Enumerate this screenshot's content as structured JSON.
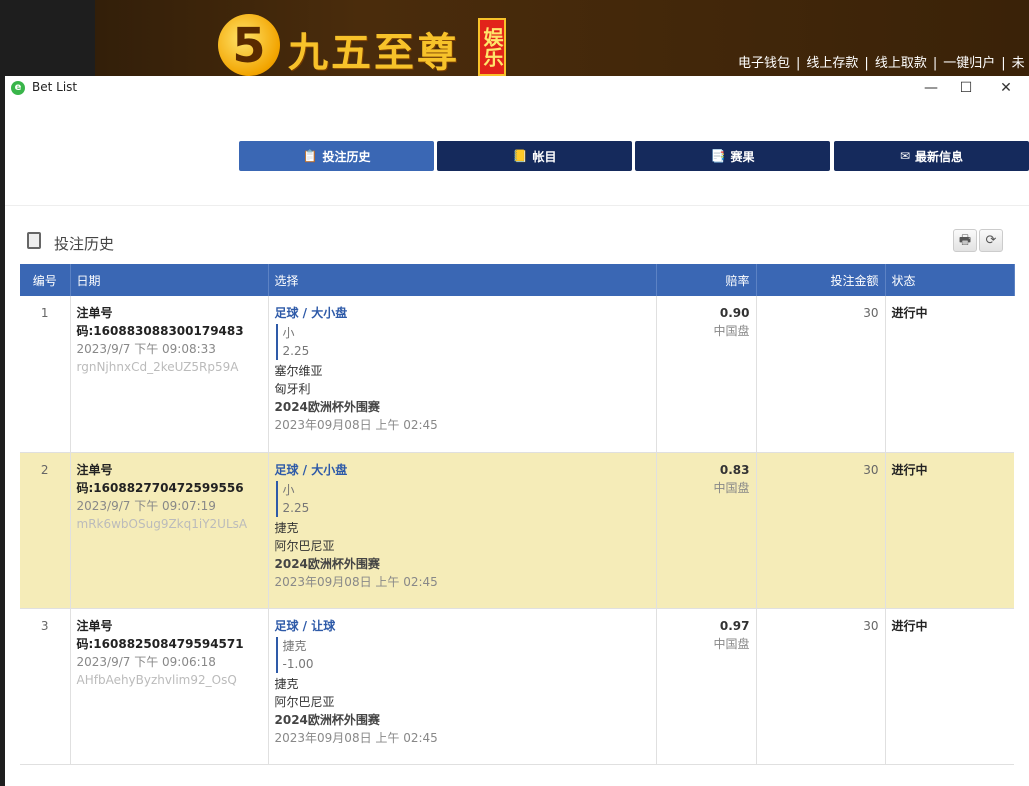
{
  "banner": {
    "logo_char": "5",
    "brand_name": "九五至尊",
    "brand_tag": "娱乐城",
    "links": [
      "电子钱包",
      "线上存款",
      "线上取款",
      "一键归户",
      "未"
    ]
  },
  "window": {
    "title": "Bet List",
    "app_icon": "e",
    "minimize_icon": "minimize-icon",
    "maximize_icon": "maximize-icon",
    "close_icon": "close-icon"
  },
  "nav": {
    "tabs": [
      {
        "label": "投注历史",
        "icon": "receipt-icon",
        "glyph": "📋",
        "active": true
      },
      {
        "label": "帐目",
        "icon": "ledger-icon",
        "glyph": "📒",
        "active": false
      },
      {
        "label": "赛果",
        "icon": "results-icon",
        "glyph": "📑",
        "active": false
      },
      {
        "label": "最新信息",
        "icon": "mail-icon",
        "glyph": "✉",
        "active": false
      }
    ]
  },
  "section": {
    "title": "投注历史",
    "print_glyph": "🖶",
    "refresh_glyph": "⟳"
  },
  "table": {
    "headers": {
      "no": "编号",
      "date": "日期",
      "selection": "选择",
      "odds": "赔率",
      "stake": "投注金额",
      "status": "状态"
    },
    "rows": [
      {
        "no": "1",
        "ticket": "注单号码:160883088300179483",
        "datetime": "2023/9/7 下午 09:08:33",
        "code": "rgnNjhnxCd_2keUZ5Rp59A",
        "sport": "足球 / 大小盘",
        "pick": "小",
        "line": "2.25",
        "home": "塞尔维亚",
        "away": "匈牙利",
        "league": "2024欧洲杯外围赛",
        "match_time": "2023年09月08日 上午 02:45",
        "odds": "0.90",
        "odds_type": "中国盘",
        "stake": "30",
        "status": "进行中",
        "highlight": false
      },
      {
        "no": "2",
        "ticket": "注单号码:160882770472599556",
        "datetime": "2023/9/7 下午 09:07:19",
        "code": "mRk6wbOSug9Zkq1iY2ULsA",
        "sport": "足球 / 大小盘",
        "pick": "小",
        "line": "2.25",
        "home": "捷克",
        "away": "阿尔巴尼亚",
        "league": "2024欧洲杯外围赛",
        "match_time": "2023年09月08日 上午 02:45",
        "odds": "0.83",
        "odds_type": "中国盘",
        "stake": "30",
        "status": "进行中",
        "highlight": true
      },
      {
        "no": "3",
        "ticket": "注单号码:160882508479594571",
        "datetime": "2023/9/7 下午 09:06:18",
        "code": "AHfbAehyByzhvlim92_OsQ",
        "sport": "足球 / 让球",
        "pick": "捷克",
        "line": "-1.00",
        "home": "捷克",
        "away": "阿尔巴尼亚",
        "league": "2024欧洲杯外围赛",
        "match_time": "2023年09月08日 上午 02:45",
        "odds": "0.97",
        "odds_type": "中国盘",
        "stake": "30",
        "status": "进行中",
        "highlight": false
      }
    ]
  }
}
